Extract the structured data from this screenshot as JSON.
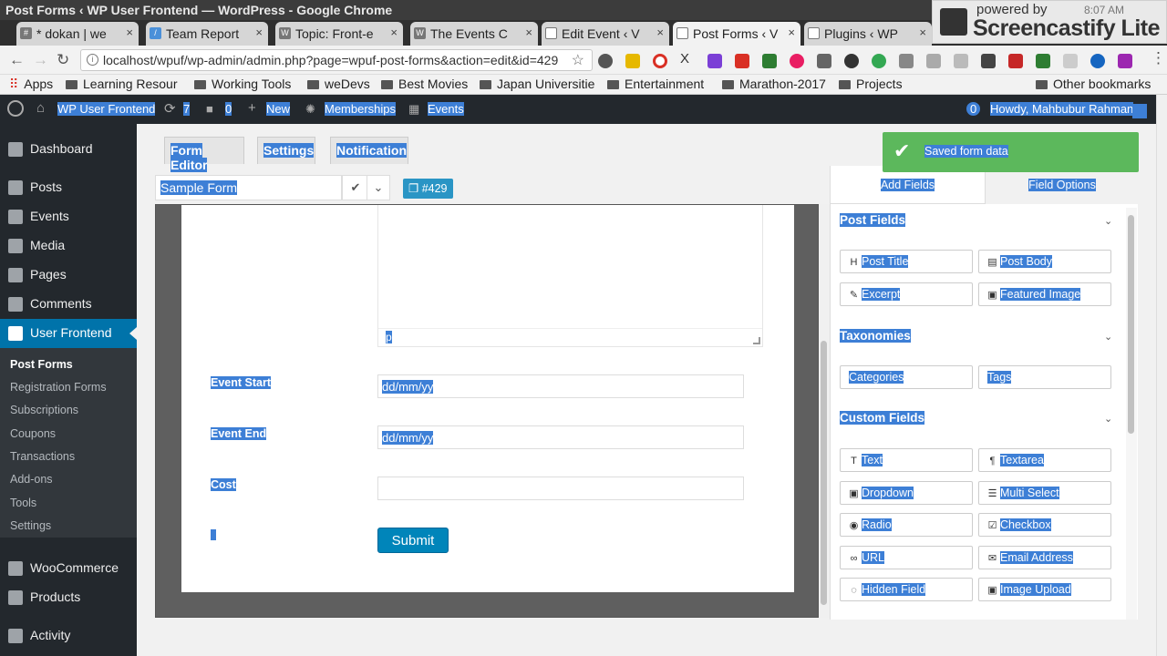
{
  "window": {
    "title": "Post Forms ‹ WP User Frontend — WordPress - Google Chrome"
  },
  "tabs": [
    {
      "label": "* dokan | we",
      "icon": "hash-icon"
    },
    {
      "label": "Team Report",
      "icon": "report-icon"
    },
    {
      "label": "Topic: Front-e",
      "icon": "wordpress-icon"
    },
    {
      "label": "The Events C",
      "icon": "wordpress-icon"
    },
    {
      "label": "Edit Event ‹ V",
      "icon": "document-icon"
    },
    {
      "label": "Post Forms ‹ V",
      "icon": "document-icon"
    },
    {
      "label": "Plugins ‹ WP",
      "icon": "document-icon"
    }
  ],
  "screencastify": {
    "powered": "powered by",
    "brand": "Screencastify Lite",
    "time": "8:07 AM"
  },
  "address_bar": {
    "url": "localhost/wpuf/wp-admin/admin.php?page=wpuf-post-forms&action=edit&id=429"
  },
  "bookmarks": [
    {
      "label": "Apps"
    },
    {
      "label": "Learning Resour"
    },
    {
      "label": "Working Tools"
    },
    {
      "label": "weDevs"
    },
    {
      "label": "Best Movies"
    },
    {
      "label": "Japan Universitie"
    },
    {
      "label": "Entertainment"
    },
    {
      "label": "Marathon-2017"
    },
    {
      "label": "Projects"
    },
    {
      "label": "Other bookmarks"
    }
  ],
  "admin_bar": {
    "site": "WP User Frontend",
    "updates": "7",
    "comments": "0",
    "new": "New",
    "memberships": "Memberships",
    "events": "Events",
    "notif_count": "0",
    "howdy": "Howdy, Mahbubur Rahman"
  },
  "sidebar": {
    "items": [
      {
        "label": "Dashboard",
        "icon": "dashboard-icon"
      },
      {
        "label": "Posts",
        "icon": "pin-icon"
      },
      {
        "label": "Events",
        "icon": "calendar-icon"
      },
      {
        "label": "Media",
        "icon": "media-icon"
      },
      {
        "label": "Pages",
        "icon": "pages-icon"
      },
      {
        "label": "Comments",
        "icon": "comment-icon"
      },
      {
        "label": "User Frontend",
        "icon": "frontend-icon"
      },
      {
        "label": "WooCommerce",
        "icon": "woo-icon"
      },
      {
        "label": "Products",
        "icon": "products-icon"
      },
      {
        "label": "Activity",
        "icon": "activity-icon"
      }
    ],
    "submenu": [
      "Post Forms",
      "Registration Forms",
      "Subscriptions",
      "Coupons",
      "Transactions",
      "Add-ons",
      "Tools",
      "Settings"
    ]
  },
  "form_nav": {
    "tabs": [
      "Form Editor",
      "Settings",
      "Notification"
    ]
  },
  "form_header": {
    "name": "Sample Form",
    "id_badge": "#429"
  },
  "preview": {
    "textarea_footer": "p",
    "fields": [
      {
        "label": "Event Start",
        "value": "dd/mm/yy"
      },
      {
        "label": "Event End",
        "value": "dd/mm/yy"
      },
      {
        "label": "Cost",
        "value": ""
      }
    ],
    "submit_label": "Submit"
  },
  "right_panel": {
    "tabs": [
      "Add Fields",
      "Field Options"
    ],
    "sections": [
      {
        "title": "Post Fields",
        "buttons": [
          {
            "label": "Post Title",
            "icon": "heading-icon"
          },
          {
            "label": "Post Body",
            "icon": "document-icon"
          },
          {
            "label": "Excerpt",
            "icon": "pen-icon"
          },
          {
            "label": "Featured Image",
            "icon": "image-icon"
          }
        ]
      },
      {
        "title": "Taxonomies",
        "buttons": [
          {
            "label": "Categories"
          },
          {
            "label": "Tags"
          }
        ]
      },
      {
        "title": "Custom Fields",
        "buttons": [
          {
            "label": "Text",
            "icon": "text-icon"
          },
          {
            "label": "Textarea",
            "icon": "paragraph-icon"
          },
          {
            "label": "Dropdown",
            "icon": "dropdown-icon"
          },
          {
            "label": "Multi Select",
            "icon": "list-icon"
          },
          {
            "label": "Radio",
            "icon": "radio-icon"
          },
          {
            "label": "Checkbox",
            "icon": "checkbox-icon"
          },
          {
            "label": "URL",
            "icon": "link-icon"
          },
          {
            "label": "Email Address",
            "icon": "envelope-icon"
          },
          {
            "label": "Hidden Field",
            "icon": "eye-slash-icon"
          },
          {
            "label": "Image Upload",
            "icon": "image-icon"
          }
        ]
      }
    ]
  },
  "notice": {
    "message": "Saved form data"
  }
}
